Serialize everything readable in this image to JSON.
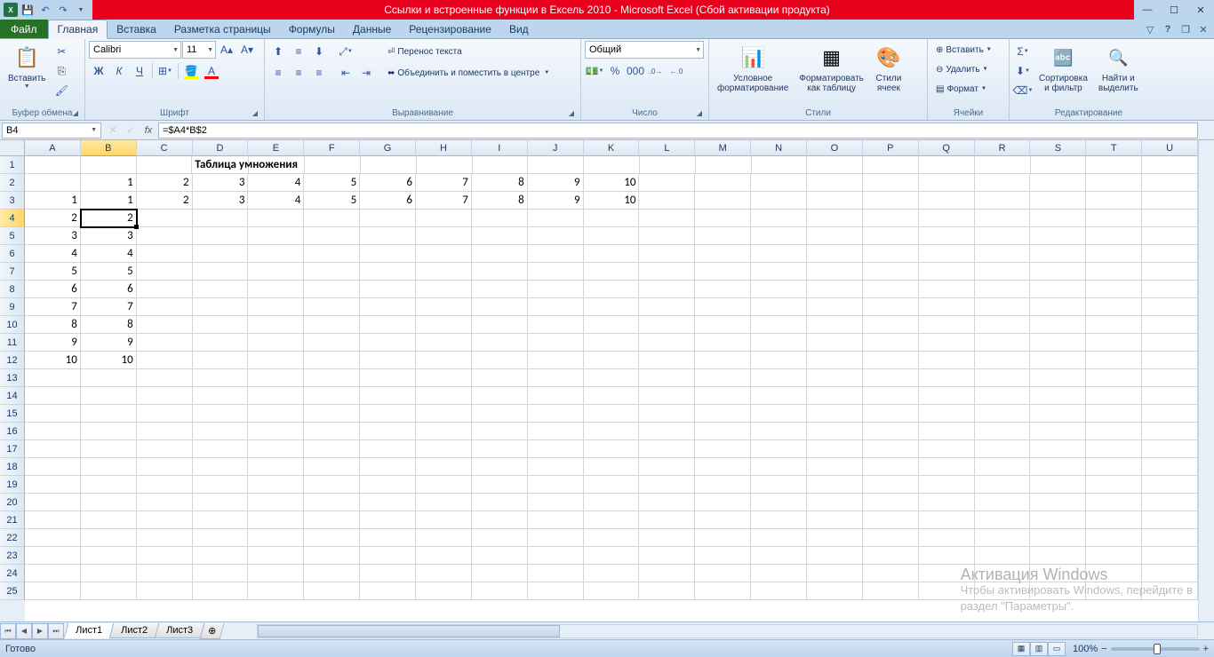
{
  "titlebar": {
    "title": "Ссылки и встроенные функции в Ексель 2010 - Microsoft Excel (Сбой активации продукта)"
  },
  "tabs": {
    "file": "Файл",
    "items": [
      "Главная",
      "Вставка",
      "Разметка страницы",
      "Формулы",
      "Данные",
      "Рецензирование",
      "Вид"
    ],
    "activeIndex": 0
  },
  "ribbon": {
    "clipboard": {
      "label": "Буфер обмена",
      "paste": "Вставить"
    },
    "font": {
      "label": "Шрифт",
      "name": "Calibri",
      "size": "11"
    },
    "alignment": {
      "label": "Выравнивание",
      "wrap": "Перенос текста",
      "merge": "Объединить и поместить в центре"
    },
    "number": {
      "label": "Число",
      "format": "Общий"
    },
    "styles": {
      "label": "Стили",
      "cond": "Условное\nформатирование",
      "table": "Форматировать\nкак таблицу",
      "cell": "Стили\nячеек"
    },
    "cells": {
      "label": "Ячейки",
      "insert": "Вставить",
      "delete": "Удалить",
      "format": "Формат"
    },
    "editing": {
      "label": "Редактирование",
      "sort": "Сортировка\nи фильтр",
      "find": "Найти и\nвыделить"
    }
  },
  "formulaBar": {
    "nameBox": "B4",
    "formula": "=$A4*B$2"
  },
  "grid": {
    "columns": [
      "A",
      "B",
      "C",
      "D",
      "E",
      "F",
      "G",
      "H",
      "I",
      "J",
      "K",
      "L",
      "M",
      "N",
      "O",
      "P",
      "Q",
      "R",
      "S",
      "T",
      "U"
    ],
    "activeCol": "B",
    "activeRow": 4,
    "title": "Таблица умножения",
    "rowHeaders": [
      1,
      2,
      3,
      4,
      5,
      6,
      7,
      8,
      9,
      10,
      11,
      12,
      13,
      14,
      15,
      16,
      17,
      18,
      19,
      20,
      21,
      22,
      23,
      24,
      25
    ],
    "data": {
      "r2": {
        "B": "1",
        "C": "2",
        "D": "3",
        "E": "4",
        "F": "5",
        "G": "6",
        "H": "7",
        "I": "8",
        "J": "9",
        "K": "10"
      },
      "r3": {
        "A": "1",
        "B": "1",
        "C": "2",
        "D": "3",
        "E": "4",
        "F": "5",
        "G": "6",
        "H": "7",
        "I": "8",
        "J": "9",
        "K": "10"
      },
      "r4": {
        "A": "2",
        "B": "2"
      },
      "r5": {
        "A": "3",
        "B": "3"
      },
      "r6": {
        "A": "4",
        "B": "4"
      },
      "r7": {
        "A": "5",
        "B": "5"
      },
      "r8": {
        "A": "6",
        "B": "6"
      },
      "r9": {
        "A": "7",
        "B": "7"
      },
      "r10": {
        "A": "8",
        "B": "8"
      },
      "r11": {
        "A": "9",
        "B": "9"
      },
      "r12": {
        "A": "10",
        "B": "10"
      }
    }
  },
  "sheets": {
    "items": [
      "Лист1",
      "Лист2",
      "Лист3"
    ],
    "activeIndex": 0
  },
  "statusbar": {
    "ready": "Готово",
    "zoom": "100%"
  },
  "watermark": {
    "heading": "Активация Windows",
    "body": "Чтобы активировать Windows, перейдите в\nраздел \"Параметры\"."
  }
}
